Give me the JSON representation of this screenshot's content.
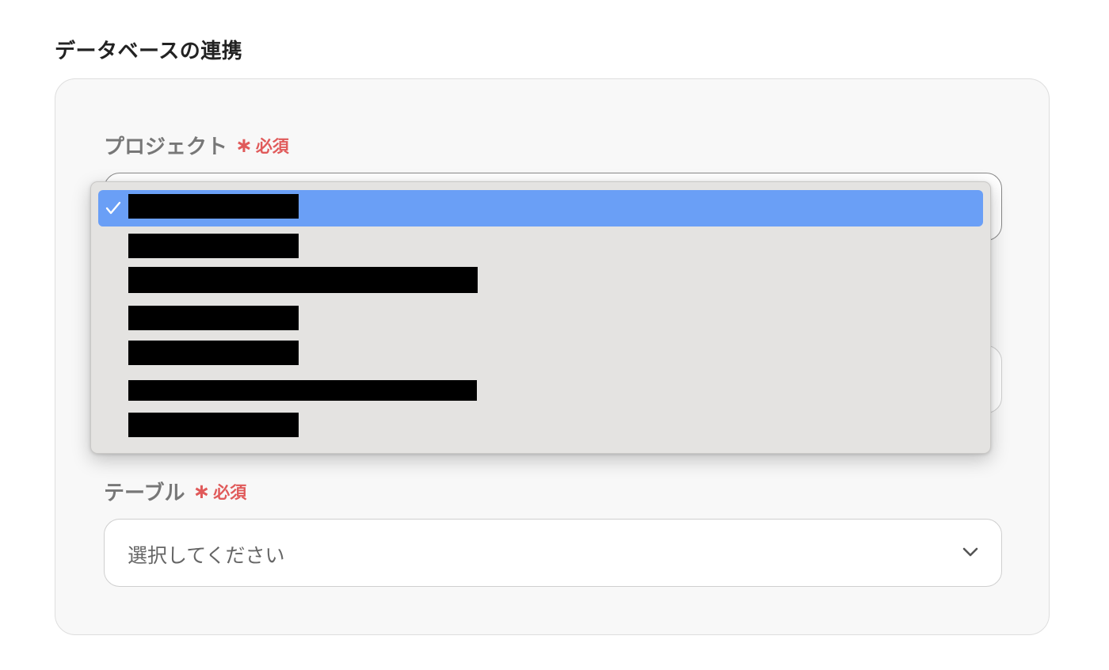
{
  "section": {
    "title": "データベースの連携"
  },
  "project_field": {
    "label": "プロジェクト",
    "required_star": "∗",
    "required_text": "必須"
  },
  "project_dropdown": {
    "options": [
      {
        "selected": true,
        "redacted": true
      },
      {
        "selected": false,
        "redacted": true
      },
      {
        "selected": false,
        "redacted": true
      },
      {
        "selected": false,
        "redacted": true
      },
      {
        "selected": false,
        "redacted": true
      },
      {
        "selected": false,
        "redacted": true
      },
      {
        "selected": false,
        "redacted": true
      }
    ],
    "check_icon": "checkmark-icon"
  },
  "table_field": {
    "label": "テーブル",
    "required_star": "∗",
    "required_text": "必須",
    "placeholder": "選択してください",
    "chevron_icon": "chevron-down-icon"
  },
  "colors": {
    "required": "#e05a5a",
    "selected_option": "#6a9ff6",
    "dropdown_bg": "#e4e3e1",
    "card_bg": "#f8f8f8"
  }
}
